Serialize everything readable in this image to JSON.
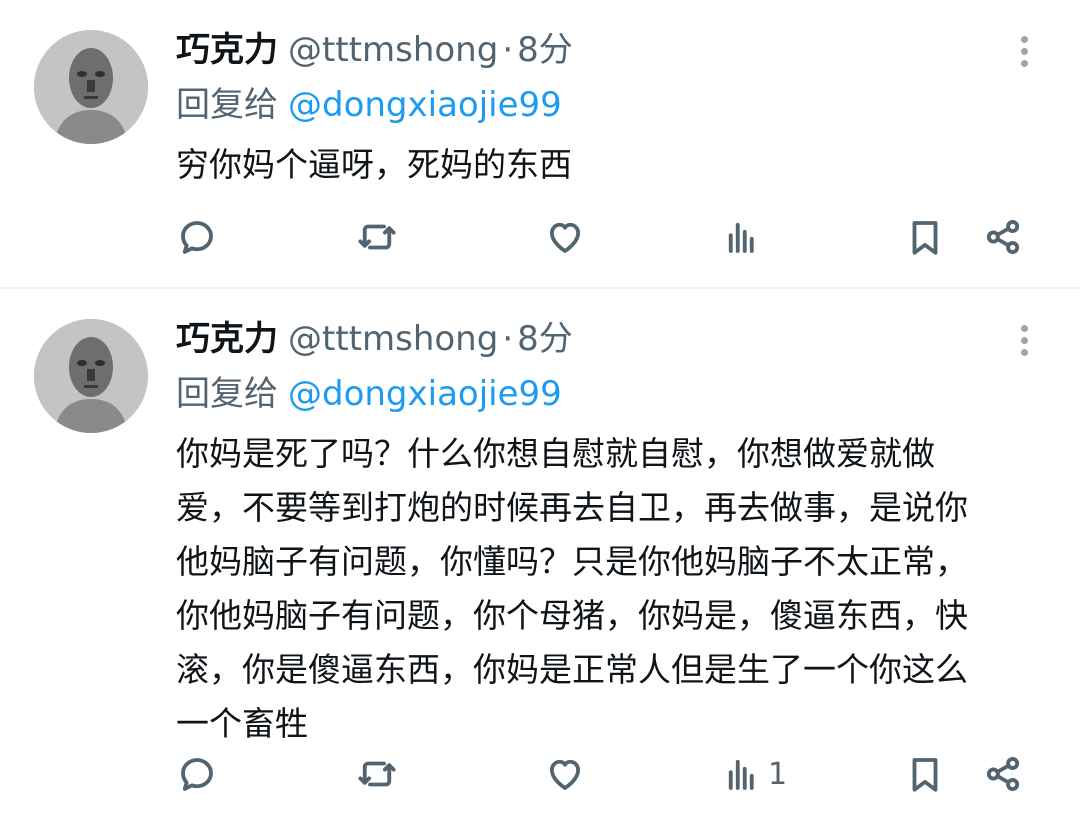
{
  "tweets": [
    {
      "author_name": "巧克力",
      "handle": "@tttmshong",
      "separator": "·",
      "time": "8分",
      "reply_prefix": "回复给",
      "reply_mention": "@dongxiaojie99",
      "text": "穷你妈个逼呀，死妈的东西",
      "views_count": ""
    },
    {
      "author_name": "巧克力",
      "handle": "@tttmshong",
      "separator": "·",
      "time": "8分",
      "reply_prefix": "回复给",
      "reply_mention": "@dongxiaojie99",
      "text_lines": [
        "你妈是死了吗？什么你想自慰就自慰，你想做爱就做",
        "爱，不要等到打炮的时候再去自卫，再去做事，是说你",
        "他妈脑子有问题，你懂吗？只是你他妈脑子不太正常，",
        "你他妈脑子有问题，你个母猪，你妈是，傻逼东西，快",
        "滚，你是傻逼东西，你妈是正常人但是生了一个你这么",
        "一个畜牲"
      ],
      "views_count": "1"
    }
  ],
  "icons": [
    "reply-icon",
    "retweet-icon",
    "like-icon",
    "views-icon",
    "bookmark-icon",
    "share-icon",
    "more-icon"
  ],
  "colors": {
    "link": "#1d9bf0",
    "secondary": "#536471",
    "text": "#0f1419",
    "divider": "#eff3f4"
  }
}
